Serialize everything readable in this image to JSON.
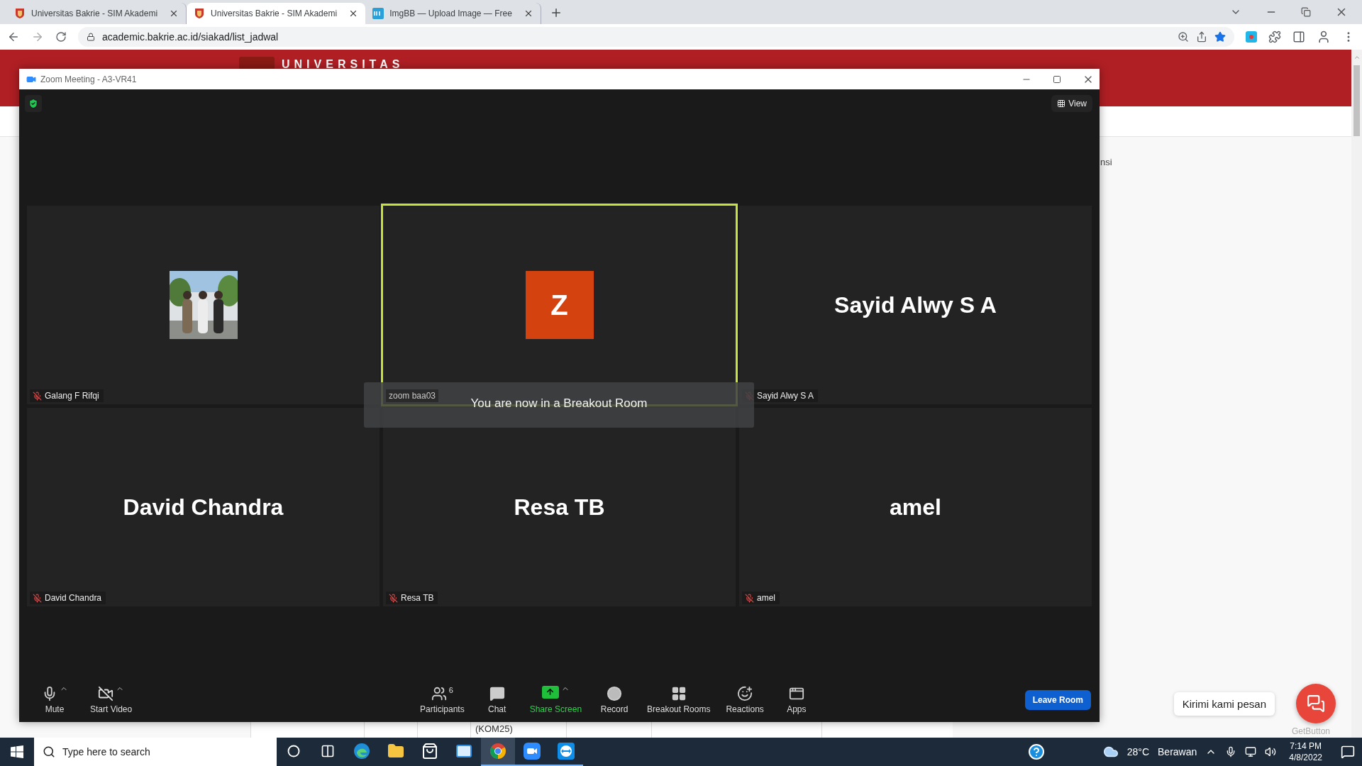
{
  "browser": {
    "tabs": [
      {
        "title": "Universitas Bakrie - SIM Akademi",
        "selected": false
      },
      {
        "title": "Universitas Bakrie - SIM Akademi",
        "selected": true
      },
      {
        "title": "ImgBB — Upload Image — Free",
        "selected": false
      }
    ],
    "address": "academic.bakrie.ac.id/siakad/list_jadwal"
  },
  "page": {
    "logo_text": "UNIVERSITAS",
    "side_text": "nsi",
    "table_cell": "(KOM25)",
    "chat_widget": {
      "bubble": "Kirimi kami pesan",
      "brand": "GetButton"
    }
  },
  "zoom": {
    "title": "Zoom Meeting - A3-VR41",
    "view_button": "View",
    "tiles": [
      {
        "label": "Galang F Rifqi",
        "muted": true,
        "speaking": false
      },
      {
        "kind": "avatar",
        "initial": "Z",
        "label": "zoom baa03",
        "muted": false,
        "speaking": true
      },
      {
        "kind": "name",
        "display": "Sayid Alwy S A",
        "label": "Sayid Alwy S A",
        "muted": true,
        "speaking": false
      },
      {
        "kind": "name",
        "display": "David Chandra",
        "label": "David Chandra",
        "muted": true,
        "speaking": false
      },
      {
        "kind": "name",
        "display": "Resa TB",
        "label": "Resa TB",
        "muted": true,
        "speaking": false
      },
      {
        "kind": "name",
        "display": "amel",
        "label": "amel",
        "muted": true,
        "speaking": false
      }
    ],
    "toast": "You are now in a Breakout Room",
    "toolbar_left": [
      {
        "kind": "mic",
        "label": "Mute",
        "caret": true
      },
      {
        "kind": "video_off",
        "label": "Start Video",
        "caret": true
      }
    ],
    "toolbar_center": [
      {
        "kind": "participants",
        "label": "Participants",
        "count": "6",
        "caret": false
      },
      {
        "kind": "chat",
        "label": "Chat",
        "caret": false
      },
      {
        "kind": "share",
        "label": "Share Screen",
        "caret": true
      },
      {
        "kind": "record",
        "label": "Record",
        "caret": false
      },
      {
        "kind": "breakout",
        "label": "Breakout Rooms",
        "caret": false
      },
      {
        "kind": "reactions",
        "label": "Reactions",
        "caret": false
      },
      {
        "kind": "apps",
        "label": "Apps",
        "caret": false
      }
    ],
    "leave_button": "Leave Room"
  },
  "taskbar": {
    "search_placeholder": "Type here to search",
    "apps": [
      {
        "kind": "cortana",
        "running": false,
        "selected": false
      },
      {
        "kind": "taskview",
        "running": false,
        "selected": false
      },
      {
        "kind": "edge",
        "running": false,
        "selected": false
      },
      {
        "kind": "explorer",
        "running": false,
        "selected": false
      },
      {
        "kind": "store",
        "running": false,
        "selected": false
      },
      {
        "kind": "mail",
        "running": false,
        "selected": false
      },
      {
        "kind": "chrome",
        "running": true,
        "selected": true
      },
      {
        "kind": "zoom",
        "running": true,
        "selected": false
      },
      {
        "kind": "teamviewer",
        "running": true,
        "selected": false
      }
    ],
    "weather": {
      "temperature": "28°C",
      "condition": "Berawan"
    },
    "time": "7:14 PM",
    "date": "4/8/2022"
  }
}
